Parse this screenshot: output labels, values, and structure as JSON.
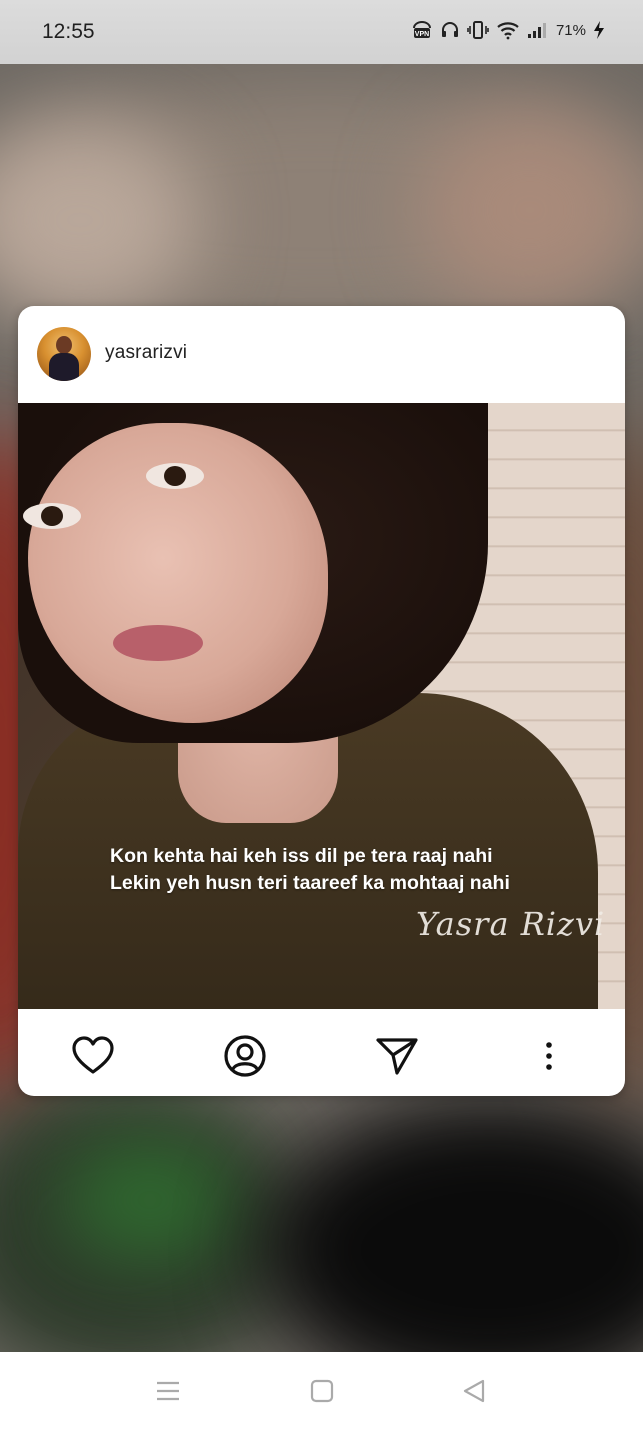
{
  "status_bar": {
    "time": "12:55",
    "battery": "71%",
    "icons": [
      "vpn-icon",
      "headset-icon",
      "vibrate-icon",
      "wifi-icon",
      "signal-icon",
      "charging-icon"
    ]
  },
  "post": {
    "username": "yasrarizvi",
    "quote_line_1": "Kon kehta hai keh iss dil pe tera raaj nahi",
    "quote_line_2": "Lekin yeh husn teri taareef ka mohtaaj nahi",
    "signature": "Yasra Rizvi"
  },
  "actions": [
    "heart-icon",
    "profile-icon",
    "send-icon",
    "more-icon"
  ],
  "navigation": [
    "menu-icon",
    "home-icon",
    "back-icon"
  ]
}
